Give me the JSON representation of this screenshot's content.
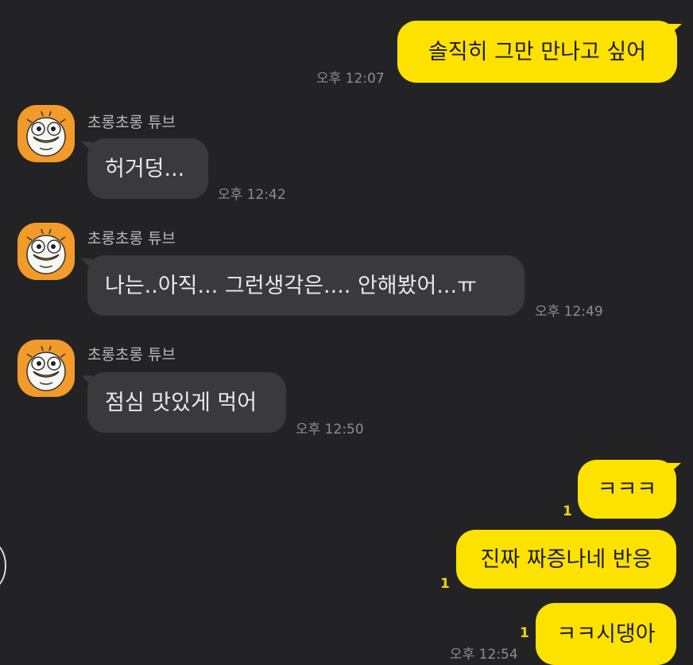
{
  "contact": {
    "name": "초롱초롱 튜브",
    "avatar_icon": "tube-duck-character-icon"
  },
  "messages": [
    {
      "direction": "out",
      "text": "솔직히 그만 만나고 싶어",
      "time": "오후 12:07"
    },
    {
      "direction": "in",
      "sender": "초롱초롱 튜브",
      "text": "허거덩...",
      "time": "오후 12:42"
    },
    {
      "direction": "in",
      "sender": "초롱초롱 튜브",
      "text": "나는..아직... 그런생각은.... 안해봤어...ㅠ",
      "time": "오후 12:49"
    },
    {
      "direction": "in",
      "sender": "초롱초롱 튜브",
      "text": "점심 맛있게 먹어",
      "time": "오후 12:50"
    },
    {
      "direction": "out",
      "text": "ㅋㅋㅋ",
      "unread": "1"
    },
    {
      "direction": "out",
      "text": "진짜 짜증나네 반응",
      "unread": "1"
    },
    {
      "direction": "out",
      "text": "ㅋㅋ시댕아",
      "unread": "1",
      "time": "오후 12:54"
    }
  ],
  "colors": {
    "background": "#232325",
    "outgoing_bubble": "#fde200",
    "incoming_bubble": "#3a3a3c",
    "timestamp": "#8d8d8f",
    "unread_count": "#f2d600",
    "avatar_bg": "#f29a2a"
  }
}
